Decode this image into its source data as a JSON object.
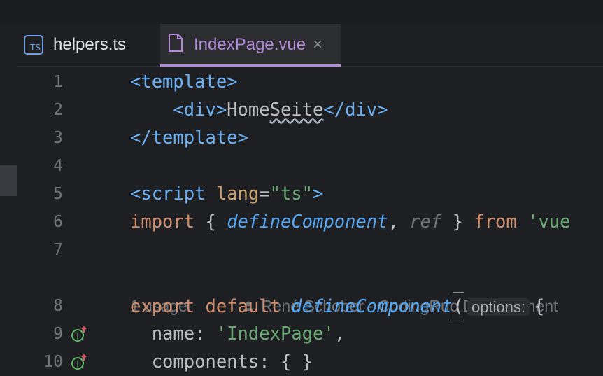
{
  "tabs": [
    {
      "label": "helpers.ts",
      "icon": "typescript-file-icon",
      "badge": "TS",
      "active": false
    },
    {
      "label": "IndexPage.vue",
      "icon": "vue-file-icon",
      "active": true
    }
  ],
  "gutter": {
    "line_numbers": [
      "1",
      "2",
      "3",
      "4",
      "5",
      "6",
      "7",
      "8",
      "9",
      "10"
    ]
  },
  "code": {
    "l1": {
      "t1": "<template>"
    },
    "l2": {
      "t1": "    <div>",
      "t2": "Home",
      "t3": "Seite",
      "t4": "</div>"
    },
    "l3": {
      "t1": "</template>"
    },
    "l5": {
      "t1": "<script ",
      "t2": "lang",
      "t3": "=",
      "t4": "\"ts\"",
      "t5": ">"
    },
    "l6": {
      "t1": "import",
      "t2": " { ",
      "t3": "defineComponent",
      "t4": ", ",
      "t5": "ref",
      "t6": " } ",
      "t7": "from",
      "t8": " 'vue"
    },
    "inlay": {
      "usage": "1 usage",
      "author": "René Schober - CodingRuo Development"
    },
    "l8": {
      "t1": "export default ",
      "t2": "defineComponent",
      "t3": "(",
      "hint": "options:",
      "t4": "{"
    },
    "l9": {
      "t1": "  name",
      "t2": ": ",
      "t3": "'IndexPage'",
      "t4": ","
    },
    "l10": {
      "t1": "  components",
      "t2": ": { }"
    }
  },
  "colors": {
    "accent": "#b48ad8",
    "background": "#1e1f22"
  }
}
